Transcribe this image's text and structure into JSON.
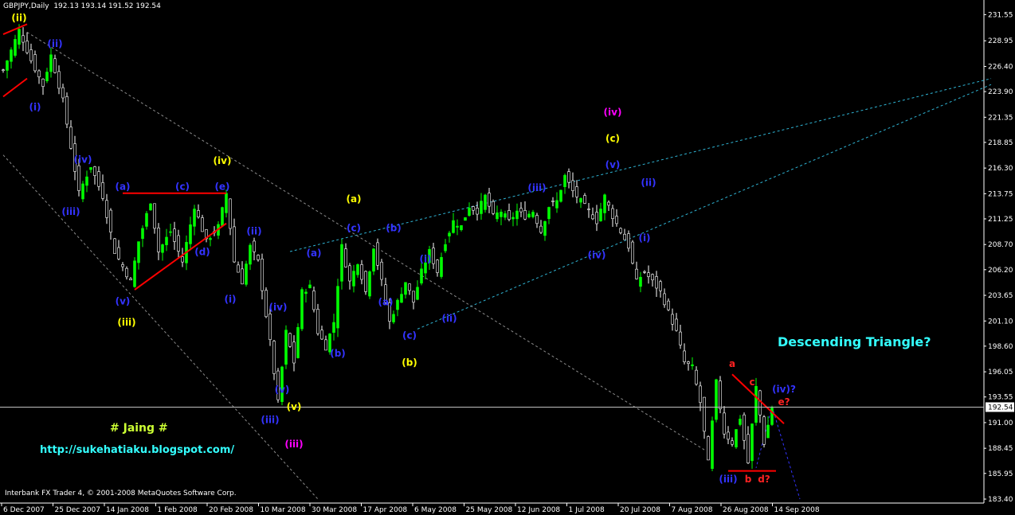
{
  "header": {
    "symbol": "GBPJPY,Daily",
    "ohlc": "192.13 193.14 191.52 192.54"
  },
  "footer": {
    "copyright": "Interbank FX Trader 4, © 2001-2008 MetaQuotes Software Corp."
  },
  "annotations": {
    "descending": "Descending Triangle?",
    "author": "# Jaing #",
    "url": "http://sukehatiaku.blogspot.com/"
  },
  "colors": {
    "background": "#000000",
    "bull_candle": "#00ff00",
    "bear_candle": "#ffffff",
    "wave_blue": "#3333ff",
    "wave_yellow": "#ffff00",
    "wave_magenta": "#ff00ff",
    "wave_red": "#ff2222",
    "trend_red": "#ff0000",
    "trend_cyan": "#2fb4d4",
    "channel_grey": "#8c8c8c",
    "title_cyan": "#33ffff",
    "author_yellow": "#ccff33",
    "url_cyan": "#33ffff"
  },
  "chart_data": {
    "type": "candlestick",
    "symbol": "GBPJPY",
    "timeframe": "Daily",
    "current_price": 192.54,
    "ylim": [
      183.4,
      231.5
    ],
    "y_ticks": [
      "231.55",
      "228.95",
      "226.40",
      "223.90",
      "221.35",
      "218.85",
      "216.30",
      "213.75",
      "211.25",
      "208.70",
      "206.20",
      "203.65",
      "201.10",
      "198.60",
      "196.05",
      "193.55",
      "191.00",
      "188.45",
      "185.95",
      "183.40"
    ],
    "x_ticks": [
      "6 Dec 2007",
      "25 Dec 2007",
      "14 Jan 2008",
      "1 Feb 2008",
      "20 Feb 2008",
      "10 Mar 2008",
      "30 Mar 2008",
      "17 Apr 2008",
      "6 May 2008",
      "25 May 2008",
      "12 Jun 2008",
      "1 Jul 2008",
      "20 Jul 2008",
      "7 Aug 2008",
      "26 Aug 2008",
      "14 Sep 2008"
    ],
    "price_path": [
      [
        0,
        226.0
      ],
      [
        4,
        230.0
      ],
      [
        7,
        227.0
      ],
      [
        10,
        224.5
      ],
      [
        12,
        227.5
      ],
      [
        15,
        223.0
      ],
      [
        19,
        213.8
      ],
      [
        22,
        216.5
      ],
      [
        25,
        213.5
      ],
      [
        28,
        208.0
      ],
      [
        32,
        205.0
      ],
      [
        34,
        209.0
      ],
      [
        37,
        213.0
      ],
      [
        39,
        208.0
      ],
      [
        42,
        210.0
      ],
      [
        45,
        207.0
      ],
      [
        48,
        212.5
      ],
      [
        51,
        209.0
      ],
      [
        54,
        210.5
      ],
      [
        56,
        213.8
      ],
      [
        58,
        207.0
      ],
      [
        60,
        205.0
      ],
      [
        62,
        208.5
      ],
      [
        64,
        207.0
      ],
      [
        67,
        199.0
      ],
      [
        69,
        193.0
      ],
      [
        71,
        200.0
      ],
      [
        73,
        197.0
      ],
      [
        75,
        204.0
      ],
      [
        77,
        204.5
      ],
      [
        79,
        200.0
      ],
      [
        81,
        198.5
      ],
      [
        83,
        201.0
      ],
      [
        85,
        208.5
      ],
      [
        87,
        205.0
      ],
      [
        89,
        207.0
      ],
      [
        91,
        204.0
      ],
      [
        93,
        208.5
      ],
      [
        95,
        205.0
      ],
      [
        97,
        201.0
      ],
      [
        99,
        203.0
      ],
      [
        101,
        205.0
      ],
      [
        103,
        203.0
      ],
      [
        105,
        206.0
      ],
      [
        107,
        208.0
      ],
      [
        109,
        206.0
      ],
      [
        111,
        209.0
      ],
      [
        113,
        211.0
      ],
      [
        115,
        210.5
      ],
      [
        117,
        212.5
      ],
      [
        119,
        212.0
      ],
      [
        121,
        213.5
      ],
      [
        123,
        211.5
      ],
      [
        125,
        212.0
      ],
      [
        127,
        211.0
      ],
      [
        129,
        212.0
      ],
      [
        131,
        211.5
      ],
      [
        133,
        212.0
      ],
      [
        135,
        210.0
      ],
      [
        137,
        212.5
      ],
      [
        139,
        213.0
      ],
      [
        141,
        215.5
      ],
      [
        143,
        214.0
      ],
      [
        145,
        213.0
      ],
      [
        147,
        212.0
      ],
      [
        149,
        211.0
      ],
      [
        151,
        213.5
      ],
      [
        153,
        211.5
      ],
      [
        155,
        210.0
      ],
      [
        157,
        208.5
      ],
      [
        159,
        205.0
      ],
      [
        161,
        206.0
      ],
      [
        163,
        205.0
      ],
      [
        165,
        204.0
      ],
      [
        167,
        202.0
      ],
      [
        169,
        200.0
      ],
      [
        171,
        197.0
      ],
      [
        173,
        196.5
      ],
      [
        175,
        193.0
      ],
      [
        177,
        187.0
      ],
      [
        179,
        195.0
      ],
      [
        181,
        190.0
      ],
      [
        183,
        189.0
      ],
      [
        185,
        191.5
      ],
      [
        187,
        187.0
      ],
      [
        189,
        194.5
      ],
      [
        191,
        189.0
      ],
      [
        193,
        192.5
      ]
    ]
  },
  "wave_labels": [
    {
      "text": "(ii)",
      "color": "yellow",
      "idx": 4,
      "price": 230.6,
      "pos": "above",
      "big": true
    },
    {
      "text": "(ii)",
      "color": "blue",
      "idx": 13,
      "price": 228.0,
      "pos": "above"
    },
    {
      "text": "(i)",
      "color": "blue",
      "idx": 8,
      "price": 223.0,
      "pos": "below"
    },
    {
      "text": "(iv)",
      "color": "blue",
      "idx": 20,
      "price": 216.5,
      "pos": "above"
    },
    {
      "text": "(iii)",
      "color": "blue",
      "idx": 17,
      "price": 212.6,
      "pos": "below"
    },
    {
      "text": "(a)",
      "color": "blue",
      "idx": 30,
      "price": 213.8,
      "pos": "above"
    },
    {
      "text": "(c)",
      "color": "blue",
      "idx": 45,
      "price": 213.8,
      "pos": "above"
    },
    {
      "text": "(e)",
      "color": "blue",
      "idx": 55,
      "price": 213.8,
      "pos": "above"
    },
    {
      "text": "(iv)",
      "color": "yellow",
      "idx": 55,
      "price": 216.4,
      "pos": "above",
      "big": true
    },
    {
      "text": "(d)",
      "color": "blue",
      "idx": 50,
      "price": 208.6,
      "pos": "below"
    },
    {
      "text": "(v)",
      "color": "blue",
      "idx": 30,
      "price": 203.7,
      "pos": "below"
    },
    {
      "text": "(iii)",
      "color": "yellow",
      "idx": 31,
      "price": 201.6,
      "pos": "below",
      "big": true
    },
    {
      "text": "(ii)",
      "color": "blue",
      "idx": 63,
      "price": 209.4,
      "pos": "above"
    },
    {
      "text": "(i)",
      "color": "blue",
      "idx": 57,
      "price": 203.9,
      "pos": "below"
    },
    {
      "text": "(iv)",
      "color": "blue",
      "idx": 69,
      "price": 203.1,
      "pos": "below"
    },
    {
      "text": "(v)",
      "color": "blue",
      "idx": 70,
      "price": 194.9,
      "pos": "below"
    },
    {
      "text": "(iii)",
      "color": "blue",
      "idx": 67,
      "price": 191.9,
      "pos": "below"
    },
    {
      "text": "(v)",
      "color": "yellow",
      "idx": 73,
      "price": 193.2,
      "pos": "below",
      "big": true
    },
    {
      "text": "(iii)",
      "color": "magenta",
      "idx": 73,
      "price": 189.5,
      "pos": "below",
      "big": true
    },
    {
      "text": "(a)",
      "color": "blue",
      "idx": 78,
      "price": 207.2,
      "pos": "above"
    },
    {
      "text": "(b)",
      "color": "blue",
      "idx": 84,
      "price": 198.5,
      "pos": "below"
    },
    {
      "text": "(c)",
      "color": "blue",
      "idx": 88,
      "price": 209.7,
      "pos": "above"
    },
    {
      "text": "(a)",
      "color": "yellow",
      "idx": 88,
      "price": 212.6,
      "pos": "above",
      "big": true
    },
    {
      "text": "(a)",
      "color": "blue",
      "idx": 96,
      "price": 203.6,
      "pos": "below"
    },
    {
      "text": "(b)",
      "color": "blue",
      "idx": 98,
      "price": 209.7,
      "pos": "above"
    },
    {
      "text": "(c)",
      "color": "blue",
      "idx": 102,
      "price": 200.3,
      "pos": "below"
    },
    {
      "text": "(b)",
      "color": "yellow",
      "idx": 102,
      "price": 197.6,
      "pos": "below",
      "big": true
    },
    {
      "text": "(i)",
      "color": "blue",
      "idx": 106,
      "price": 206.6,
      "pos": "above"
    },
    {
      "text": "(ii)",
      "color": "blue",
      "idx": 112,
      "price": 202.0,
      "pos": "below"
    },
    {
      "text": "(iii)",
      "color": "blue",
      "idx": 134,
      "price": 213.7,
      "pos": "above"
    },
    {
      "text": "(iv)",
      "color": "blue",
      "idx": 149,
      "price": 208.3,
      "pos": "below"
    },
    {
      "text": "(v)",
      "color": "blue",
      "idx": 153,
      "price": 216.0,
      "pos": "above"
    },
    {
      "text": "(c)",
      "color": "yellow",
      "idx": 153,
      "price": 218.6,
      "pos": "above",
      "big": true
    },
    {
      "text": "(iv)",
      "color": "magenta",
      "idx": 153,
      "price": 221.2,
      "pos": "above",
      "big": true
    },
    {
      "text": "(ii)",
      "color": "blue",
      "idx": 162,
      "price": 214.2,
      "pos": "above"
    },
    {
      "text": "(i)",
      "color": "blue",
      "idx": 161,
      "price": 210.0,
      "pos": "below"
    },
    {
      "text": "a",
      "color": "red",
      "idx": 183,
      "price": 196.2,
      "pos": "above"
    },
    {
      "text": "c",
      "color": "red",
      "idx": 188,
      "price": 194.4,
      "pos": "above"
    },
    {
      "text": "(iv)?",
      "color": "blue",
      "idx": 196,
      "price": 193.7,
      "pos": "above"
    },
    {
      "text": "e?",
      "color": "red",
      "idx": 196,
      "price": 192.4,
      "pos": "above"
    },
    {
      "text": "(iii)",
      "color": "blue",
      "idx": 182,
      "price": 186.0,
      "pos": "below"
    },
    {
      "text": "b",
      "color": "red",
      "idx": 187,
      "price": 186.0,
      "pos": "below"
    },
    {
      "text": "d?",
      "color": "red",
      "idx": 191,
      "price": 186.0,
      "pos": "below"
    }
  ],
  "trend_lines": [
    {
      "color": "red",
      "from": [
        0,
        229.6
      ],
      "to": [
        6,
        230.6
      ]
    },
    {
      "color": "red",
      "from": [
        0,
        223.4
      ],
      "to": [
        6,
        225.2
      ]
    },
    {
      "color": "red",
      "from": [
        30,
        213.8
      ],
      "to": [
        56,
        213.8
      ]
    },
    {
      "color": "red",
      "from": [
        33,
        204.2
      ],
      "to": [
        56,
        210.8
      ]
    },
    {
      "color": "red",
      "from": [
        183,
        195.8
      ],
      "to": [
        196,
        190.9
      ]
    },
    {
      "color": "red",
      "from": [
        182,
        186.2
      ],
      "to": [
        194,
        186.2
      ]
    }
  ],
  "dashed_lines": [
    {
      "color": "cyan",
      "from": [
        72,
        208.0
      ],
      "to": [
        248,
        225.2
      ]
    },
    {
      "color": "cyan",
      "from": [
        104,
        200.3
      ],
      "to": [
        248,
        224.6
      ]
    },
    {
      "color": "grey",
      "from": [
        6,
        229.8
      ],
      "to": [
        176,
        188.3
      ]
    },
    {
      "color": "grey",
      "from": [
        0,
        217.6
      ],
      "to": [
        79,
        183.4
      ]
    },
    {
      "color": "blue",
      "from": [
        193,
        192.6
      ],
      "to": [
        189,
        186.5
      ]
    },
    {
      "color": "blue",
      "from": [
        193,
        192.6
      ],
      "to": [
        200,
        183.4
      ]
    }
  ]
}
